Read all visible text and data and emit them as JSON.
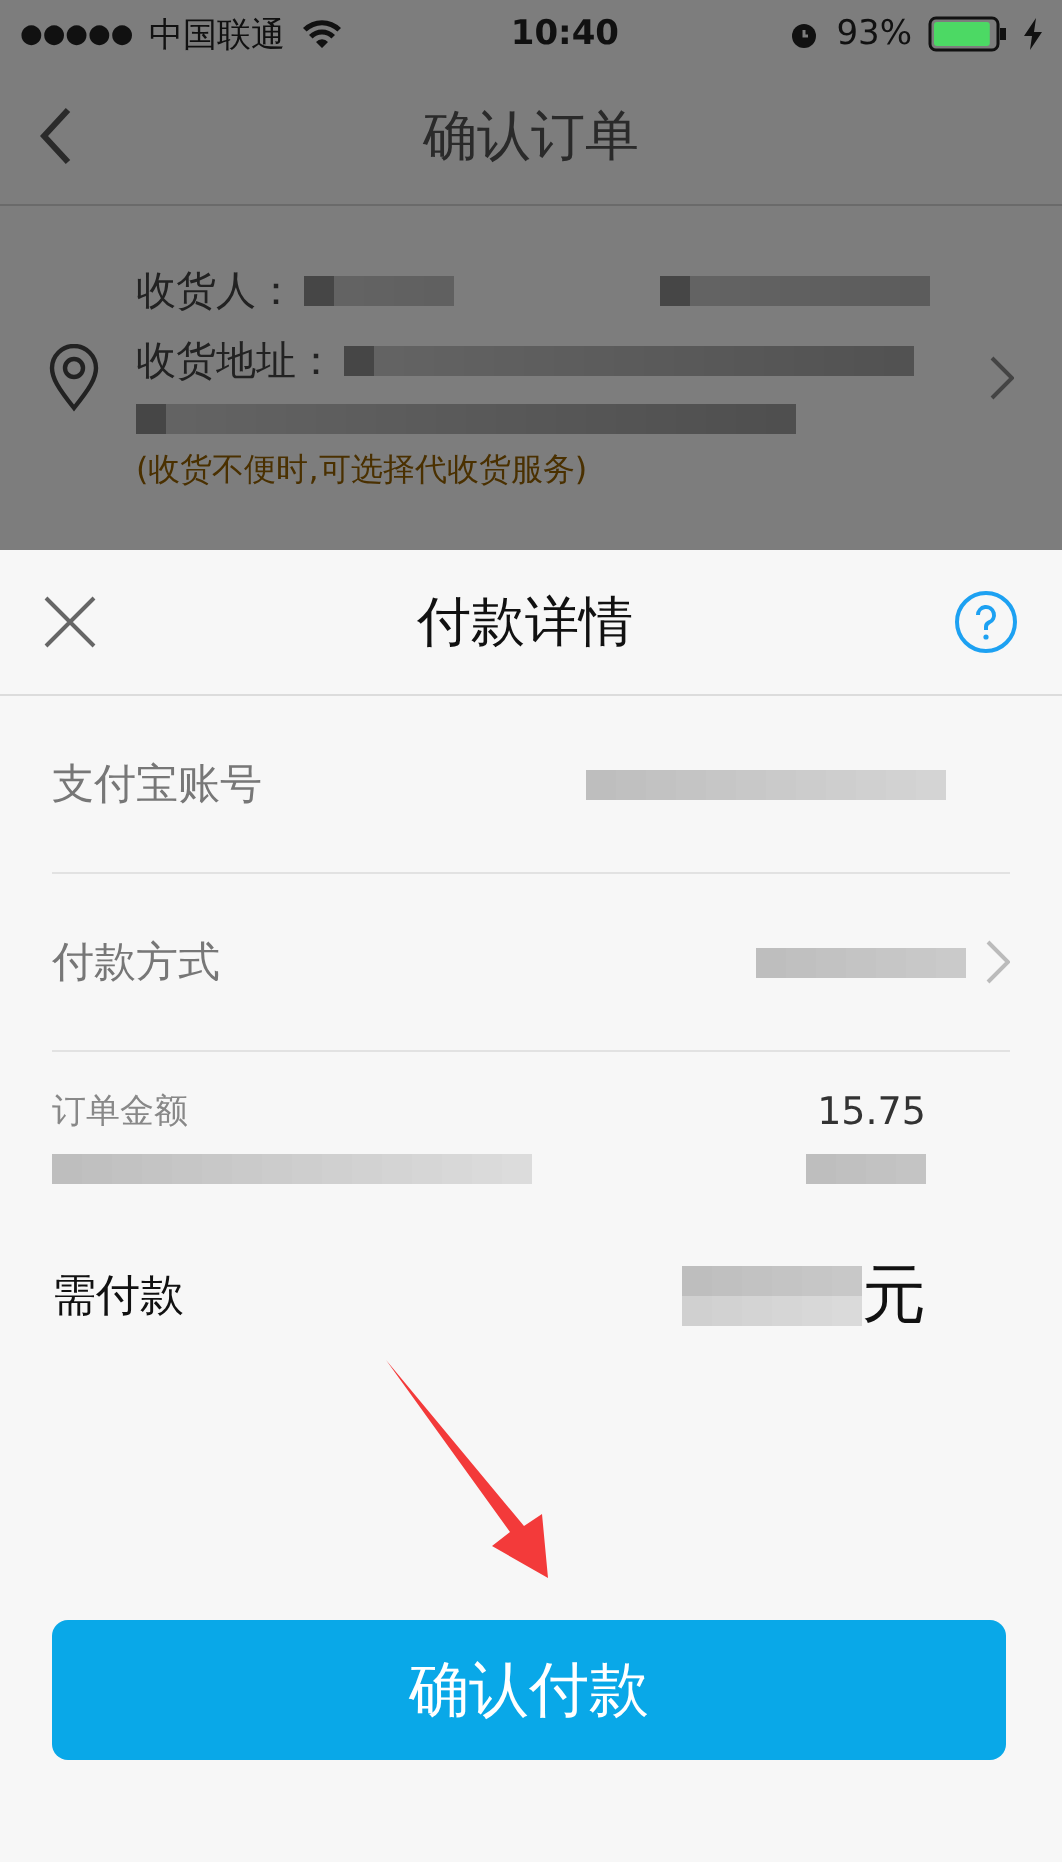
{
  "status_bar": {
    "signal": "●●●●●",
    "carrier": "中国联通",
    "time": "10:40",
    "battery": "93%",
    "charging": true
  },
  "nav": {
    "title": "确认订单"
  },
  "address": {
    "recipient_label": "收货人：",
    "address_label": "收货地址：",
    "note": "(收货不便时,可选择代收货服务)"
  },
  "sheet": {
    "title": "付款详情",
    "rows": [
      {
        "kind": "plain",
        "label": "支付宝账号"
      },
      {
        "kind": "nav",
        "label": "付款方式"
      }
    ],
    "amount": {
      "label": "订单金额",
      "value": "15.75"
    },
    "total": {
      "label": "需付款",
      "unit": "元"
    },
    "button": "确认付款"
  }
}
